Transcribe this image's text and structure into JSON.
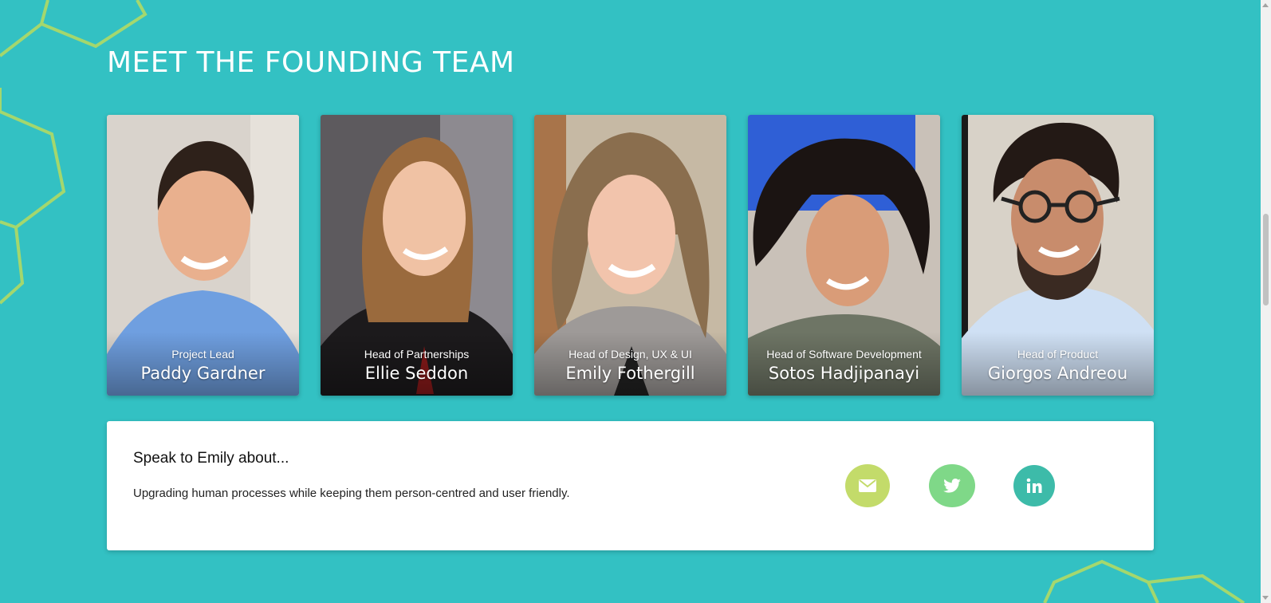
{
  "section": {
    "title": "MEET THE FOUNDING TEAM"
  },
  "team": [
    {
      "role": "Project Lead",
      "name": "Paddy Gardner"
    },
    {
      "role": "Head of Partnerships",
      "name": "Ellie Seddon"
    },
    {
      "role": "Head of Design, UX & UI",
      "name": "Emily Fothergill"
    },
    {
      "role": "Head of Software Development",
      "name": "Sotos Hadjipanayi"
    },
    {
      "role": "Head of Product",
      "name": "Giorgos Andreou"
    }
  ],
  "detail": {
    "heading": "Speak to Emily about...",
    "text": "Upgrading human processes while keeping them person-centred and user friendly.",
    "social": [
      {
        "icon": "envelope-icon",
        "color": "#c3db6a"
      },
      {
        "icon": "twitter-icon",
        "color": "#7fd888"
      },
      {
        "icon": "linkedin-icon",
        "color": "#3dbba9"
      }
    ]
  },
  "colors": {
    "background": "#33c1c3",
    "hex_outline": "#b5dc63",
    "panel": "#ffffff"
  }
}
